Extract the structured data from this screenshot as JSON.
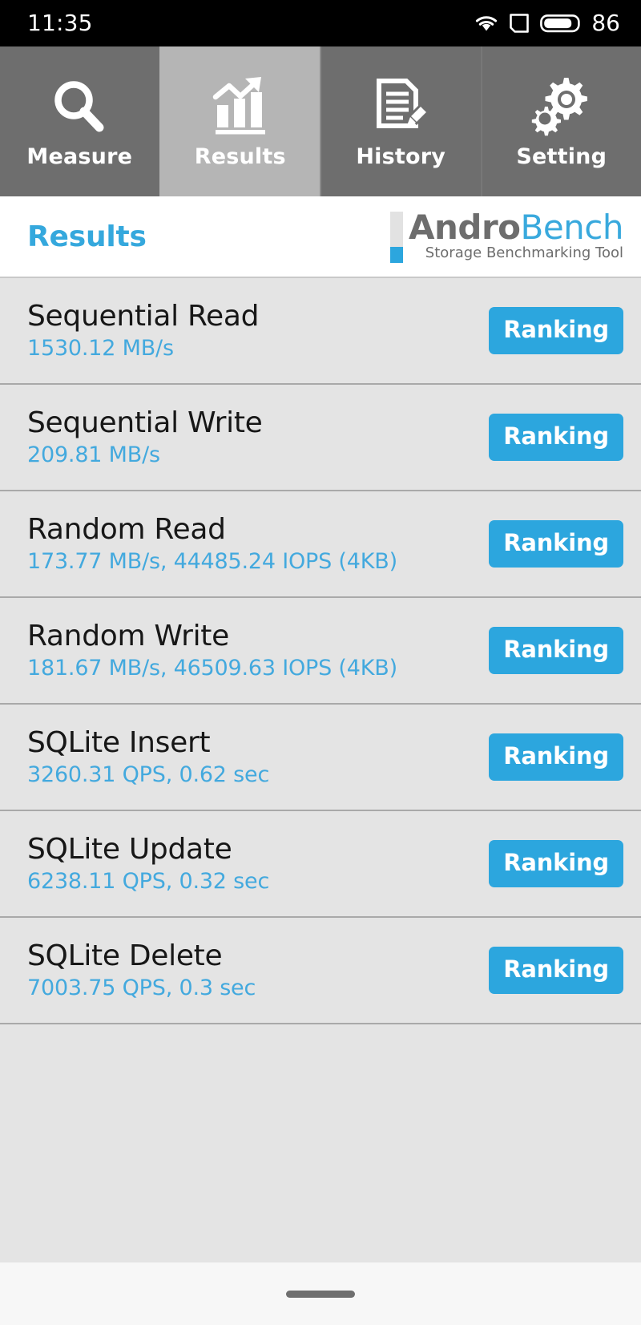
{
  "status_bar": {
    "time": "11:35",
    "battery_percent": "86",
    "icons": [
      "wifi-icon",
      "sim-card-icon",
      "battery-icon"
    ]
  },
  "tabs": [
    {
      "label": "Measure",
      "icon": "magnifier-icon",
      "active": false
    },
    {
      "label": "Results",
      "icon": "bar-chart-trend-icon",
      "active": true
    },
    {
      "label": "History",
      "icon": "document-pencil-icon",
      "active": false
    },
    {
      "label": "Setting",
      "icon": "gears-icon",
      "active": false
    }
  ],
  "header": {
    "title": "Results",
    "logo": {
      "word_part1": "Andro",
      "word_part2": "Bench",
      "subtitle": "Storage Benchmarking Tool"
    }
  },
  "results": [
    {
      "title": "Sequential Read",
      "value": "1530.12 MB/s",
      "button": "Ranking"
    },
    {
      "title": "Sequential Write",
      "value": "209.81 MB/s",
      "button": "Ranking"
    },
    {
      "title": "Random Read",
      "value": "173.77 MB/s, 44485.24 IOPS (4KB)",
      "button": "Ranking"
    },
    {
      "title": "Random Write",
      "value": "181.67 MB/s, 46509.63 IOPS (4KB)",
      "button": "Ranking"
    },
    {
      "title": "SQLite Insert",
      "value": "3260.31 QPS, 0.62 sec",
      "button": "Ranking"
    },
    {
      "title": "SQLite Update",
      "value": "6238.11 QPS, 0.32 sec",
      "button": "Ranking"
    },
    {
      "title": "SQLite Delete",
      "value": "7003.75 QPS, 0.3 sec",
      "button": "Ranking"
    }
  ],
  "navigation_bar": {
    "gesture_handle": "home-gesture-bar"
  },
  "colors": {
    "accent_blue": "#2ca6de",
    "title_blue": "#35a8dd",
    "value_blue": "#43a9de",
    "tab_inactive": "#6e6e6e",
    "tab_active": "#b5b5b5",
    "list_background": "#e4e4e4",
    "status_bar": "#000000"
  }
}
